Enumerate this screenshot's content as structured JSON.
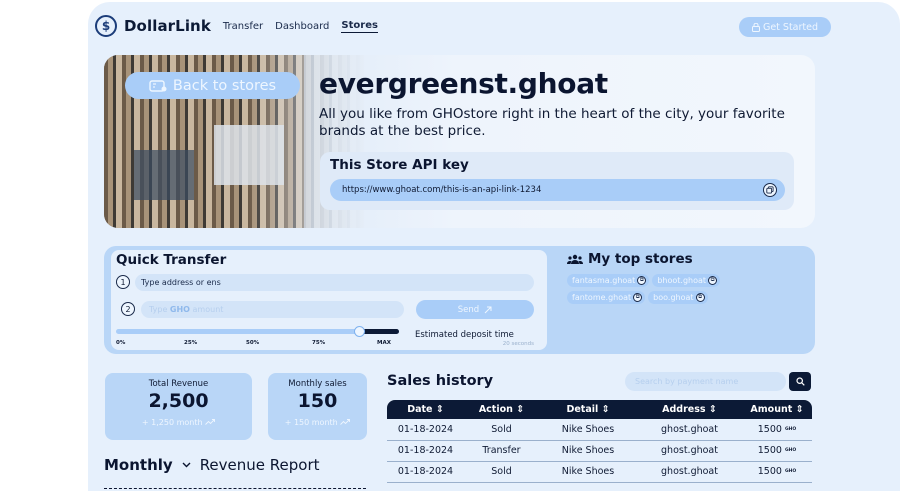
{
  "nav": {
    "logo_symbol": "$",
    "brand": "DollarLink",
    "links": [
      "Transfer",
      "Dashboard",
      "Stores"
    ],
    "active": "Stores",
    "cta_label": "Get Started"
  },
  "hero": {
    "back_label": "Back to stores",
    "store_name": "evergreenst.ghoat",
    "description": "All you like from GHOstore right in the heart of the city, your favorite brands at the best price.",
    "api_title": "This Store API key",
    "api_value": "https://www.ghoat.com/this-is-an-api-link-1234"
  },
  "quick_transfer": {
    "title": "Quick Transfer",
    "step1": "1",
    "step2": "2",
    "address_placeholder": "Type address or ens",
    "amount_placeholder_prefix": "Type ",
    "amount_placeholder_token": "GHO",
    "amount_placeholder_suffix": " amount",
    "send_label": "Send",
    "slider_value_percent": 86,
    "ticks": [
      "0%",
      "25%",
      "50%",
      "75%",
      "MAX"
    ],
    "estimate_label": "Estimated deposit time",
    "estimate_value": "20 seconds"
  },
  "top_stores": {
    "title": "My top stores",
    "stores": [
      "fantasma.ghoat",
      "bhoot.ghoat",
      "fantome.ghoat",
      "boo.ghoat"
    ]
  },
  "stats": {
    "revenue": {
      "label": "Total Revenue",
      "value": "2,500",
      "change": "+ 1,250 month"
    },
    "monthly": {
      "label": "Monthly sales",
      "value": "150",
      "change": "+ 150 month"
    }
  },
  "report": {
    "period": "Monthly",
    "title": "Revenue Report"
  },
  "sales": {
    "title": "Sales history",
    "search_placeholder": "Search by payment name",
    "columns": [
      "Date",
      "Action",
      "Detail",
      "Address",
      "Amount"
    ],
    "rows": [
      {
        "date": "01-18-2024",
        "action": "Sold",
        "detail": "Nike Shoes",
        "address": "ghost.ghoat",
        "amount": "1500",
        "unit": "GHO"
      },
      {
        "date": "01-18-2024",
        "action": "Transfer",
        "detail": "Nike Shoes",
        "address": "ghost.ghoat",
        "amount": "1500",
        "unit": "GHO"
      },
      {
        "date": "01-18-2024",
        "action": "Sold",
        "detail": "Nike Shoes",
        "address": "ghost.ghoat",
        "amount": "1500",
        "unit": "GHO"
      }
    ]
  },
  "colors": {
    "navy": "#0c1a36",
    "accent_light": "#a9cdf8",
    "panel": "#e6f0fc",
    "card": "#b9d6f7"
  },
  "icons": {
    "logo": "dollar-circle-icon",
    "cta": "lock-icon",
    "back": "store-icon",
    "copy": "copy-icon",
    "send": "arrow-up-right-icon",
    "top_stores": "users-icon",
    "trend": "trend-up-icon",
    "search": "search-icon",
    "sort": "sort-icon",
    "dropdown": "chevron-down-icon"
  }
}
